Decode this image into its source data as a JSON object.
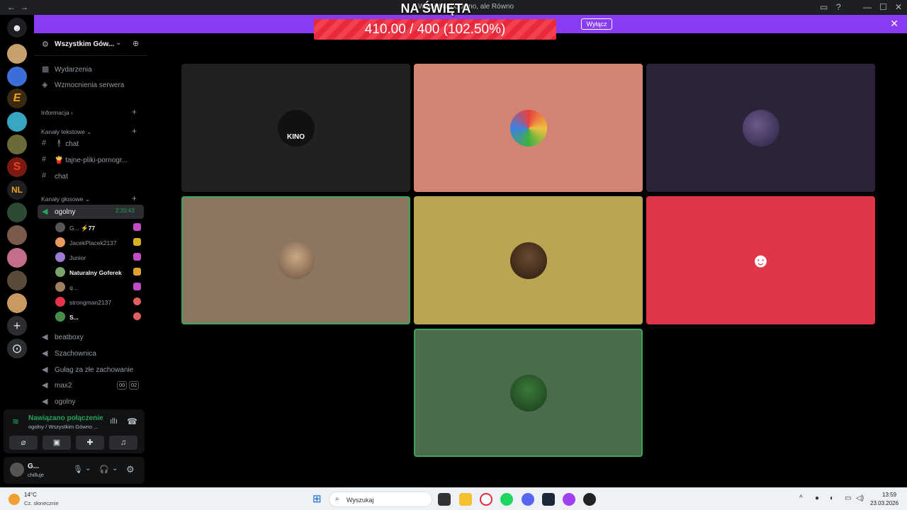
{
  "window": {
    "title": "Wszystkim Gówno, ale Równo",
    "overlay_heading": "NA ŚWIĘTA"
  },
  "notice": {
    "progress_text": "410.00 / 400 (102.50%)",
    "button_label": "Wyłącz",
    "close_icon": "✕"
  },
  "guild": {
    "name": "Wszystkim Gów...",
    "events_label": "Wydarzenia",
    "boosts_label": "Wzmocnienia serwera",
    "categories": {
      "info": "Informacja",
      "text": "Kanały tekstowe",
      "voice": "Kanały głosowe"
    },
    "text_channels": [
      {
        "name": "🕴 chat"
      },
      {
        "name": "🍟 tajne-pliki-pornogr..."
      },
      {
        "name": "chat"
      }
    ],
    "active_voice": {
      "name": "ogolny",
      "timer": "2:20:43"
    },
    "voice_users": [
      {
        "name": "G...",
        "extra": "⚡77",
        "color": "#555555"
      },
      {
        "name": "JacekPlacek2137",
        "extra": "",
        "color": "#e89a60"
      },
      {
        "name": "Junior",
        "extra": "",
        "color": "#9c7bd2"
      },
      {
        "name": "Naturalny Goferek",
        "extra": "",
        "color": "#7aa36b"
      },
      {
        "name": "q...",
        "extra": "",
        "color": "#a08060"
      },
      {
        "name": "strongman2137",
        "extra": "",
        "color": "#e8334a"
      },
      {
        "name": "S...",
        "extra": "",
        "color": "#4a8a4a"
      }
    ],
    "voice_channels": [
      {
        "name": "beatboxy"
      },
      {
        "name": "Szachownica"
      },
      {
        "name": "Gułag za złe zachowanie"
      },
      {
        "name": "max2",
        "pill_a": "00",
        "pill_b": "02"
      },
      {
        "name": "ogolny"
      }
    ]
  },
  "rtc": {
    "status": "Nawiązano połączenie",
    "channel": "ogolny / Wszystkim Gówno ..."
  },
  "me": {
    "name": "G...",
    "status": "chilluje"
  },
  "tiles": [
    {
      "label": "KINO",
      "color": "#212121"
    },
    {
      "label": "",
      "color": "#d48472"
    },
    {
      "label": "",
      "color": "#2c2338"
    },
    {
      "label": "",
      "color": "#8b7761"
    },
    {
      "label": "",
      "color": "#b9a552"
    },
    {
      "label": "",
      "color": "#e0364a"
    },
    {
      "label": "",
      "color": "#4a6b4c"
    }
  ],
  "taskbar": {
    "weather_temp": "14°C",
    "weather_desc": "Cz. słonecznie",
    "search_placeholder": "Wyszukaj",
    "time": "13:59",
    "date": "23.03.2026"
  },
  "colors": {
    "accent_purple": "#8a3cf5",
    "speaking_green": "#3ba55c",
    "progress_red": "#e8293c"
  }
}
